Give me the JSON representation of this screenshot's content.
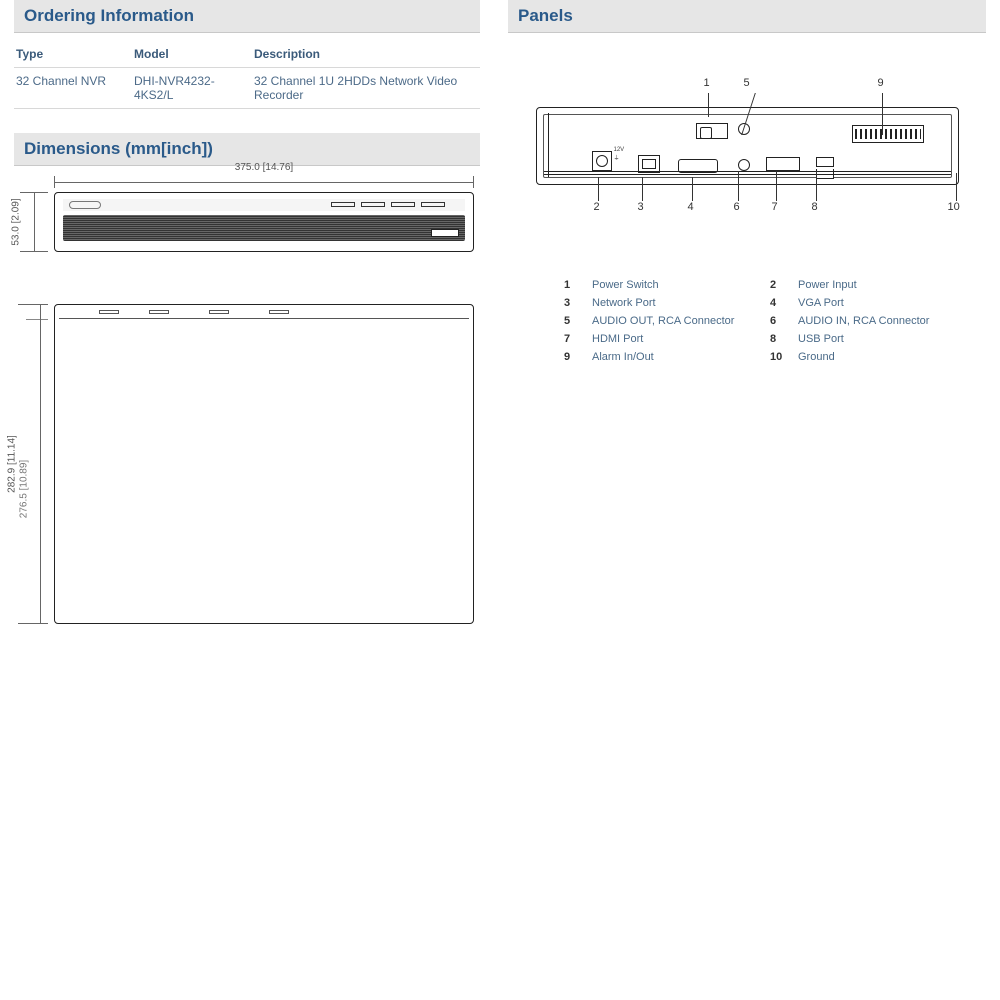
{
  "ordering": {
    "title": "Ordering Information",
    "headers": {
      "type": "Type",
      "model": "Model",
      "desc": "Description"
    },
    "row": {
      "type": "32 Channel NVR",
      "model": "DHI-NVR4232-4KS2/L",
      "desc": "32 Channel 1U 2HDDs Network Video Recorder"
    }
  },
  "dimensions": {
    "title": "Dimensions (mm[inch])",
    "width": "375.0  [14.76]",
    "height": "53.0  [2.09]",
    "depth_outer": "282.9  [11.14]",
    "depth_inner": "276.5  [10.89]"
  },
  "panels": {
    "title": "Panels",
    "callouts": {
      "n1": "1",
      "n2": "2",
      "n3": "3",
      "n4": "4",
      "n5": "5",
      "n6": "6",
      "n7": "7",
      "n8": "8",
      "n9": "9",
      "n10": "10"
    },
    "legend": [
      {
        "num": "1",
        "label": "Power Switch"
      },
      {
        "num": "2",
        "label": "Power Input"
      },
      {
        "num": "3",
        "label": "Network Port"
      },
      {
        "num": "4",
        "label": "VGA Port"
      },
      {
        "num": "5",
        "label": "AUDIO OUT, RCA Connector"
      },
      {
        "num": "6",
        "label": "AUDIO IN, RCA Connector"
      },
      {
        "num": "7",
        "label": "HDMI Port"
      },
      {
        "num": "8",
        "label": "USB Port"
      },
      {
        "num": "9",
        "label": "Alarm In/Out"
      },
      {
        "num": "10",
        "label": "Ground"
      }
    ]
  }
}
